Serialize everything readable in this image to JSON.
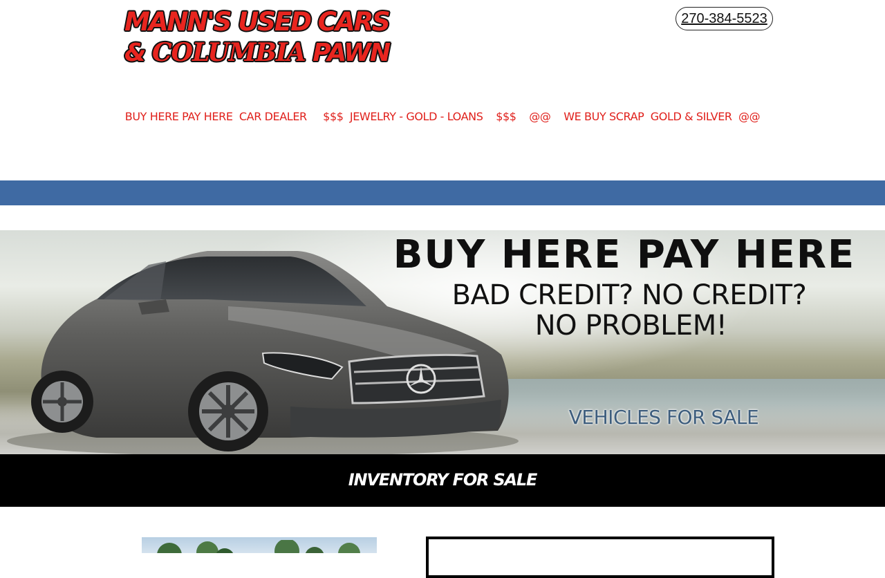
{
  "header": {
    "logo_line1": "MANN'S USED CARS",
    "logo_line2_prefix": "& ",
    "logo_line2_script": "COLUMBIA",
    "logo_line2_suffix": " PAWN",
    "phone": "270-384-5523"
  },
  "tagline": "BUY HERE PAY HERE  CAR DEALER     $$$  JEWELRY - GOLD - LOANS    $$$    @@    WE BUY SCRAP  GOLD & SILVER  @@",
  "hero": {
    "headline": "BUY HERE PAY HERE",
    "subline1": "BAD CREDIT? NO CREDIT?",
    "subline2": "NO PROBLEM!",
    "vehicles_link": "VEHICLES FOR SALE"
  },
  "inventory_banner": "INVENTORY FOR SALE",
  "colors": {
    "brand_red": "#e8251f",
    "blue_band": "#3f6aa3",
    "banner_black": "#000000"
  }
}
